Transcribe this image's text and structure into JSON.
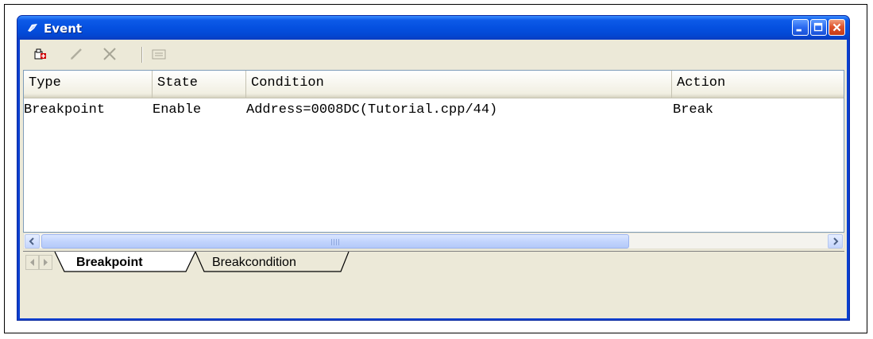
{
  "window": {
    "title": "Event",
    "accent": "#0550e0",
    "close_color": "#e0552e"
  },
  "toolbar": {
    "icons": [
      "add-event-icon",
      "edit-icon",
      "delete-icon",
      "properties-icon"
    ]
  },
  "list": {
    "columns": [
      "Type",
      "State",
      "Condition",
      "Action"
    ],
    "rows": [
      {
        "type": "Breakpoint",
        "state": "Enable",
        "condition": "Address=0008DC(Tutorial.cpp/44)",
        "action": "Break"
      }
    ]
  },
  "scrollbar": {
    "grip": "III"
  },
  "tabs": [
    {
      "label": "Breakpoint",
      "selected": true
    },
    {
      "label": "Breakcondition",
      "selected": false
    }
  ]
}
